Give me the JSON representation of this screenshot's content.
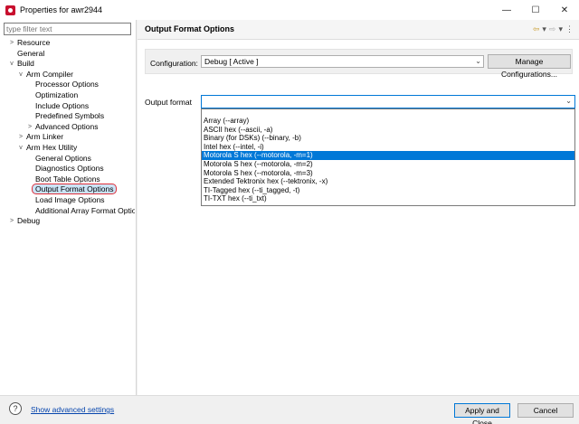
{
  "window": {
    "title": "Properties for awr2944",
    "minimize": "—",
    "maximize": "☐",
    "close": "✕"
  },
  "sidebar": {
    "filter_placeholder": "type filter text",
    "items": [
      {
        "label": "Resource",
        "arrow": ">"
      },
      {
        "label": "General",
        "arrow": ""
      },
      {
        "label": "Build",
        "arrow": "v"
      },
      {
        "label": "Arm Compiler",
        "arrow": "v"
      },
      {
        "label": "Processor Options",
        "arrow": ""
      },
      {
        "label": "Optimization",
        "arrow": ""
      },
      {
        "label": "Include Options",
        "arrow": ""
      },
      {
        "label": "Predefined Symbols",
        "arrow": ""
      },
      {
        "label": "Advanced Options",
        "arrow": ">"
      },
      {
        "label": "Arm Linker",
        "arrow": ">"
      },
      {
        "label": "Arm Hex Utility",
        "arrow": "v"
      },
      {
        "label": "General Options",
        "arrow": ""
      },
      {
        "label": "Diagnostics Options",
        "arrow": ""
      },
      {
        "label": "Boot Table Options",
        "arrow": ""
      },
      {
        "label": "Output Format Options",
        "arrow": ""
      },
      {
        "label": "Load Image Options",
        "arrow": ""
      },
      {
        "label": "Additional Array Format Options",
        "arrow": ""
      },
      {
        "label": "Debug",
        "arrow": ">"
      }
    ]
  },
  "main": {
    "title": "Output Format Options",
    "nav": {
      "back": "⇦",
      "back_menu": "▾",
      "forward": "⇨",
      "forward_menu": "▾",
      "more": "⋮"
    },
    "configuration": {
      "label": "Configuration:",
      "value": "Debug  [ Active ]",
      "manage_button": "Manage Configurations..."
    },
    "output_format": {
      "label": "Output format",
      "value": "",
      "selected_index": 4,
      "options": [
        "Array (--array)",
        "ASCII hex (--ascii, -a)",
        "Binary (for DSKs) (--binary, -b)",
        "Intel hex (--intel, -i)",
        "Motorola S hex (--motorola, -m=1)",
        "Motorola S hex (--motorola, -m=2)",
        "Motorola S hex (--motorola, -m=3)",
        "Extended Tektronix hex (--tektronix, -x)",
        "TI-Tagged hex (--ti_tagged, -t)",
        "TI-TXT hex (--ti_txt)"
      ]
    }
  },
  "footer": {
    "help_icon": "?",
    "advanced_link": "Show advanced settings",
    "apply_close": "Apply and Close",
    "cancel": "Cancel"
  }
}
